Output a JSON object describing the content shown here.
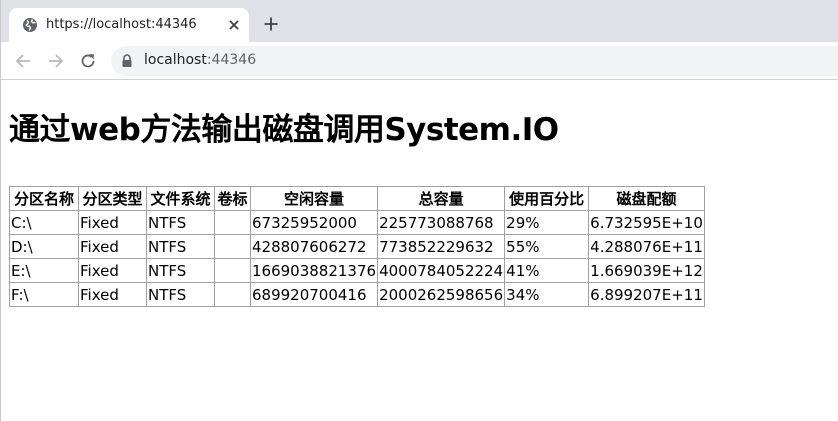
{
  "tab": {
    "title": "https://localhost:44346",
    "favicon": "globe-icon",
    "close": "close-icon",
    "new_tab": "plus-icon"
  },
  "toolbar": {
    "back": "back-arrow-icon",
    "forward": "forward-arrow-icon",
    "reload": "reload-icon",
    "lock": "lock-icon",
    "url_host": "localhost",
    "url_port": ":44346"
  },
  "page": {
    "heading": "通过web方法输出磁盘调用System.IO"
  },
  "table": {
    "headers": [
      "分区名称",
      "分区类型",
      "文件系统",
      "卷标",
      "空闲容量",
      "总容量",
      "使用百分比",
      "磁盘配额"
    ],
    "rows": [
      [
        "C:\\",
        "Fixed",
        "NTFS",
        "",
        "67325952000",
        "225773088768",
        "29%",
        "6.732595E+10"
      ],
      [
        "D:\\",
        "Fixed",
        "NTFS",
        "",
        "428807606272",
        "773852229632",
        "55%",
        "4.288076E+11"
      ],
      [
        "E:\\",
        "Fixed",
        "NTFS",
        "",
        "1669038821376",
        "4000784052224",
        "41%",
        "1.669039E+12"
      ],
      [
        "F:\\",
        "Fixed",
        "NTFS",
        "",
        "689920700416",
        "2000262598656",
        "34%",
        "6.899207E+11"
      ]
    ]
  },
  "colors": {
    "tabstrip": "#dee1e6",
    "omnibox": "#f1f3f4",
    "table_border": "#a0a0a0"
  }
}
